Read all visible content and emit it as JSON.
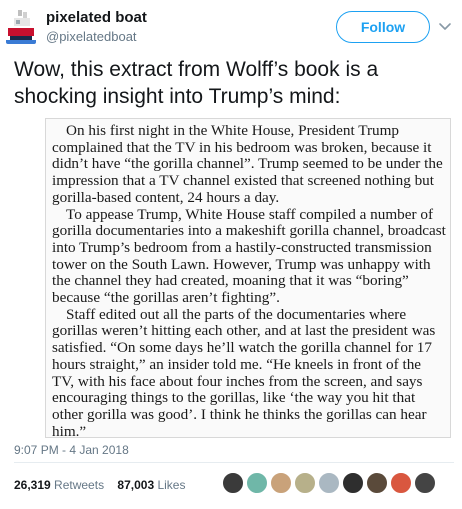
{
  "user": {
    "name": "pixelated boat",
    "handle": "@pixelatedboat"
  },
  "follow_label": "Follow",
  "tweet": {
    "text": "Wow, this extract from Wolff’s book is a shocking insight into Trump’s mind:",
    "timestamp": "9:07 PM - 4 Jan 2018"
  },
  "extract": {
    "paragraphs": [
      "On his first night in the White House, President Trump complained that the TV in his bedroom was broken, because it didn’t have “the gorilla channel”. Trump seemed to be under the impression that a TV channel existed that screened nothing but gorilla-based content, 24 hours a day.",
      "To appease Trump, White House staff compiled a number of gorilla documentaries into a makeshift gorilla channel, broadcast into Trump’s bedroom from a hastily-constructed transmission tower on the South Lawn. However, Trump was unhappy with the channel they had created, moaning that it was “boring” because “the gorillas aren’t fighting”.",
      "Staff edited out all the parts of the documentaries where gorillas weren’t hitting each other, and at last the president was satisfied. “On some days he’ll watch the gorilla channel for 17 hours straight,” an insider told me. “He kneels in front of the TV, with his face about four inches from the screen, and says encouraging things to the gorillas, like ‘the way you hit that other gorilla was good’. I think he thinks the gorillas can hear him.”"
    ]
  },
  "stats": {
    "retweets_count": "26,319",
    "retweets_label": "Retweets",
    "likes_count": "87,003",
    "likes_label": "Likes"
  },
  "likers": [
    {
      "icon": "avatar-icon",
      "color": "#3a3a3a"
    },
    {
      "icon": "avatar-icon",
      "color": "#6fb7a8"
    },
    {
      "icon": "avatar-icon",
      "color": "#c9a27a"
    },
    {
      "icon": "avatar-icon",
      "color": "#b7b08a"
    },
    {
      "icon": "avatar-icon",
      "color": "#aab8c2"
    },
    {
      "icon": "avatar-icon",
      "color": "#2e2e2e"
    },
    {
      "icon": "avatar-icon",
      "color": "#5a4a3a"
    },
    {
      "icon": "avatar-icon",
      "color": "#d9573f"
    },
    {
      "icon": "avatar-icon",
      "color": "#444444"
    }
  ],
  "colors": {
    "accent": "#1da1f2",
    "secondary_text": "#657786"
  }
}
